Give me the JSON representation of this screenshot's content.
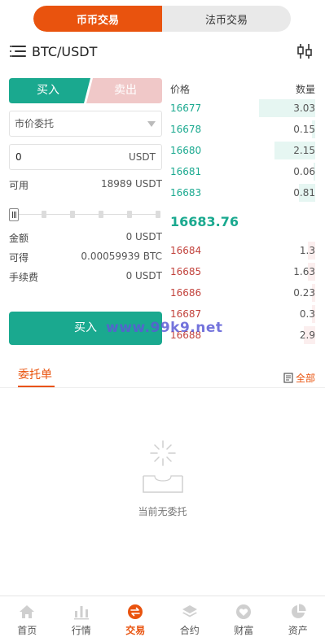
{
  "top_switch": {
    "spot": "币币交易",
    "fiat": "法币交易"
  },
  "pair": "BTC/USDT",
  "trade": {
    "buy_tab": "买入",
    "sell_tab": "卖出",
    "order_type": "市价委托",
    "amount_value": "0",
    "amount_unit": "USDT",
    "available_label": "可用",
    "available_value": "18989 USDT",
    "slider_percent": 0,
    "total_label": "金额",
    "total_value": "0 USDT",
    "receive_label": "可得",
    "receive_value": "0.00059939 BTC",
    "fee_label": "手续费",
    "fee_value": "0 USDT",
    "submit_label": "买入"
  },
  "watermark": "www.99k9.net",
  "order_book": {
    "price_header": "价格",
    "qty_header": "数量",
    "bids": [
      {
        "price": "16677",
        "qty": "3.03",
        "depth": 0.39
      },
      {
        "price": "16678",
        "qty": "0.15",
        "depth": 0.02
      },
      {
        "price": "16680",
        "qty": "2.15",
        "depth": 0.28
      },
      {
        "price": "16681",
        "qty": "0.06",
        "depth": 0.01
      },
      {
        "price": "16683",
        "qty": "0.81",
        "depth": 0.11
      }
    ],
    "last_price": "16683.76",
    "asks": [
      {
        "price": "16684",
        "qty": "1.3",
        "depth": 0.05
      },
      {
        "price": "16685",
        "qty": "1.63",
        "depth": 0.05
      },
      {
        "price": "16686",
        "qty": "0.23",
        "depth": 0.02
      },
      {
        "price": "16687",
        "qty": "0.3",
        "depth": 0.02
      },
      {
        "price": "16688",
        "qty": "2.9",
        "depth": 0.08
      }
    ],
    "bid_bar_color": "#e6f6f2",
    "ask_bar_color": "#fbeeee"
  },
  "orders": {
    "tab_label": "委托单",
    "all_label": "全部",
    "empty_text": "当前无委托"
  },
  "bottom_nav": [
    {
      "label": "首页",
      "icon": "home-icon"
    },
    {
      "label": "行情",
      "icon": "chart-bars-icon"
    },
    {
      "label": "交易",
      "icon": "swap-icon",
      "active": true
    },
    {
      "label": "合约",
      "icon": "layers-icon"
    },
    {
      "label": "财富",
      "icon": "heart-icon"
    },
    {
      "label": "资产",
      "icon": "pie-icon"
    }
  ],
  "colors": {
    "accent": "#e9530e",
    "buy": "#1aa98f",
    "sell": "#c2433d",
    "sell_tab_bg": "#f0c8c8"
  }
}
